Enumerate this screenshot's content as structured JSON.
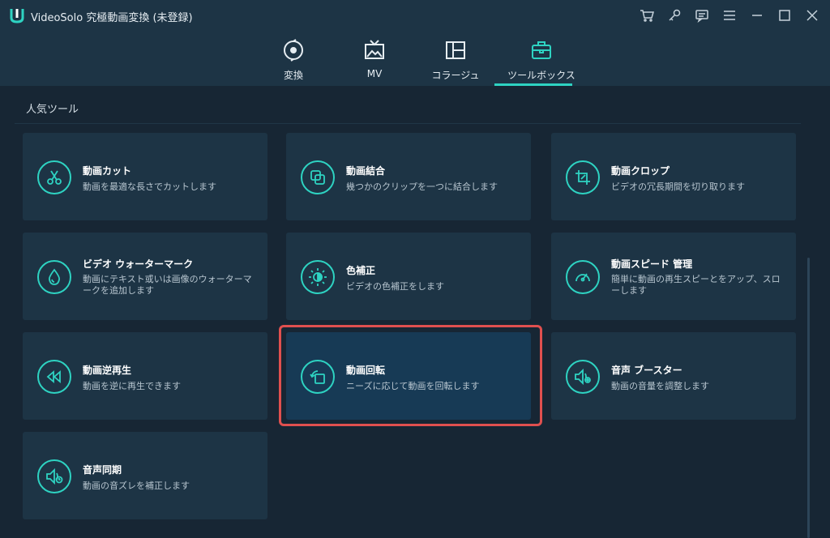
{
  "app": {
    "title": "VideoSolo 究極動画変換 (未登録)"
  },
  "window_controls": [
    "cart-icon",
    "key-icon",
    "feedback-icon",
    "menu-icon",
    "minimize-icon",
    "maximize-icon",
    "close-icon"
  ],
  "tabs": [
    {
      "label": "変換",
      "icon": "convert-icon",
      "active": false
    },
    {
      "label": "MV",
      "icon": "mv-icon",
      "active": false
    },
    {
      "label": "コラージュ",
      "icon": "collage-icon",
      "active": false
    },
    {
      "label": "ツールボックス",
      "icon": "toolbox-icon",
      "active": true
    }
  ],
  "section": {
    "title": "人気ツール"
  },
  "tools": [
    {
      "title": "動画カット",
      "desc": "動画を最適な長さでカットします",
      "icon": "scissors-icon"
    },
    {
      "title": "動画結合",
      "desc": "幾つかのクリップを一つに結合します",
      "icon": "merge-icon"
    },
    {
      "title": "動画クロップ",
      "desc": "ビデオの冗長期間を切り取ります",
      "icon": "crop-icon"
    },
    {
      "title": "ビデオ ウォーターマーク",
      "desc": "動画にテキスト或いは画像のウォーターマークを追加します",
      "icon": "watermark-icon"
    },
    {
      "title": "色補正",
      "desc": "ビデオの色補正をします",
      "icon": "color-correction-icon"
    },
    {
      "title": "動画スピード 管理",
      "desc": "簡単に動画の再生スピーとをアップ、スローします",
      "icon": "speed-icon"
    },
    {
      "title": "動画逆再生",
      "desc": "動画を逆に再生できます",
      "icon": "reverse-icon"
    },
    {
      "title": "動画回転",
      "desc": "ニーズに応じて動画を回転します",
      "icon": "rotate-icon"
    },
    {
      "title": "音声 ブースター",
      "desc": "動画の音量を調整します",
      "icon": "volume-booster-icon"
    },
    {
      "title": "音声同期",
      "desc": "動画の音ズレを補正します",
      "icon": "audio-sync-icon"
    }
  ],
  "colors": {
    "accent": "#2ed3c2",
    "highlight_border": "#e0504f",
    "card_bg": "#1d3445",
    "page_bg": "#172634"
  }
}
